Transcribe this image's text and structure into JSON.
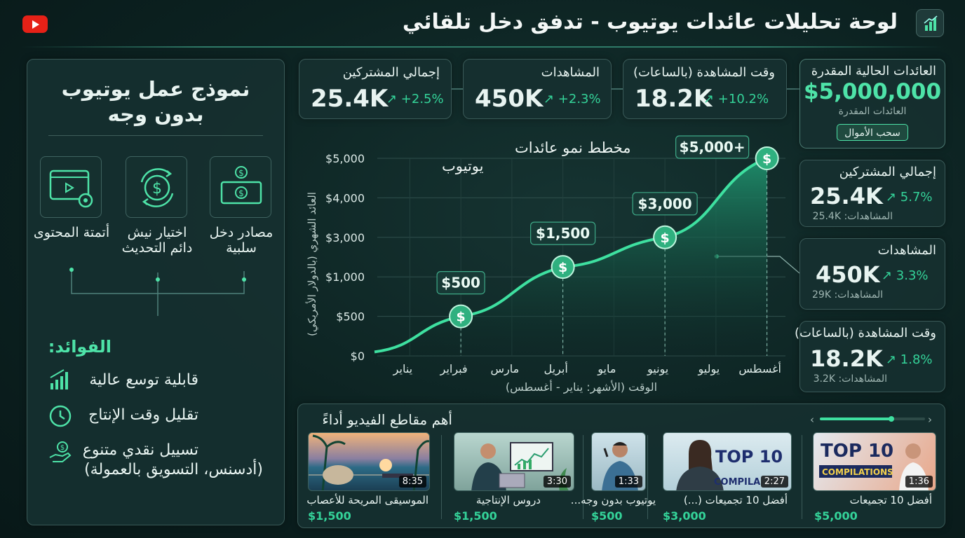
{
  "header": {
    "title": "لوحة تحليلات عائدات يوتيوب - تدفق دخل تلقائي"
  },
  "left_panel": {
    "title_line1": "نموذج عمل يوتيوب",
    "title_line2": "بدون وجه",
    "features": [
      {
        "label": "أتمتة المحتوى",
        "icon": "automation-icon"
      },
      {
        "label": "اختيار نيش دائم التحديث",
        "icon": "refresh-dollar-icon"
      },
      {
        "label": "مصادر دخل سلبية",
        "icon": "cash-icon"
      }
    ],
    "benefits_title": "الفوائد:",
    "benefits": [
      {
        "text": "قابلية توسع عالية",
        "icon": "growth-bars-icon"
      },
      {
        "text": "تقليل وقت الإنتاج",
        "icon": "clock-icon"
      },
      {
        "text": "تسييل نقدي متنوع",
        "text2": "(أدسنس، التسويق بالعمولة)",
        "icon": "hand-money-icon"
      }
    ]
  },
  "stats": [
    {
      "label": "إجمالي المشتركين",
      "value": "25.4K",
      "change": "↗ +2.5%"
    },
    {
      "label": "المشاهدات",
      "value": "450K",
      "change": "↗ +2.3%"
    },
    {
      "label": "وقت المشاهدة (بالساعات)",
      "value": "18.2K",
      "change": "↗ +10.2%"
    }
  ],
  "revenue_card": {
    "label": "العائدات الحالية المقدرة",
    "value": "$5,000,000",
    "sub": "العائدات المقدرة",
    "button": "سحب الأموال"
  },
  "side_stats": [
    {
      "label": "إجمالي المشتركين",
      "value": "25.4K",
      "change": "↗ 5.7%",
      "sub": "المشاهدات: 25.4K"
    },
    {
      "label": "المشاهدات",
      "value": "450K",
      "change": "↗ 3.3%",
      "sub": "المشاهدات: 29K"
    },
    {
      "label": "وقت المشاهدة (بالساعات)",
      "value": "18.2K",
      "change": "↗ 1.8%",
      "sub": "المشاهدات: 3.2K"
    }
  ],
  "chart_data": {
    "type": "area",
    "title_line1": "مخطط نمو عائدات",
    "title_line2": "يوتيوب",
    "xlabel": "الوقت (الأشهر: يناير - أغسطس)",
    "ylabel": "العائد الشهري (بالدولار الأمريكي)",
    "categories": [
      "يناير",
      "فبراير",
      "مارس",
      "أبريل",
      "مايو",
      "يونيو",
      "يوليو",
      "أغسطس"
    ],
    "y_ticks": [
      "$0",
      "$500",
      "$1,000",
      "$3,000",
      "$4,000",
      "$5,000"
    ],
    "ylim": [
      0,
      5000
    ],
    "annotations": [
      {
        "month": "فبراير",
        "label": "$500"
      },
      {
        "month": "أبريل",
        "label": "$1,500"
      },
      {
        "month": "يونيو",
        "label": "$3,000"
      },
      {
        "month": "أغسطس",
        "label": "$5,000+"
      }
    ],
    "grid": true,
    "colors": {
      "line": "#3ee0a0",
      "fill": "#1f8f6c"
    }
  },
  "videos": {
    "title": "أهم مقاطع الفيديو أداءً",
    "items": [
      {
        "title": "الموسيقى المريحة للأعصاب",
        "price": "$1,500",
        "duration": "8:35"
      },
      {
        "title": "دروس الإنتاجية",
        "price": "$1,500",
        "duration": "3:30"
      },
      {
        "title": "يوتيوب بدون وجه...",
        "price": "$500",
        "duration": "1:33"
      },
      {
        "title": "أفضل 10 تجميعات (...)",
        "price": "$3,000",
        "duration": "2:27",
        "thumb_text1": "TOP 10",
        "thumb_text2": "COMPILA"
      },
      {
        "title": "أفضل 10 تجميعات",
        "price": "$5,000",
        "duration": "1:36",
        "thumb_text1": "TOP 10",
        "thumb_text2": "COMPILATIONS"
      }
    ]
  }
}
